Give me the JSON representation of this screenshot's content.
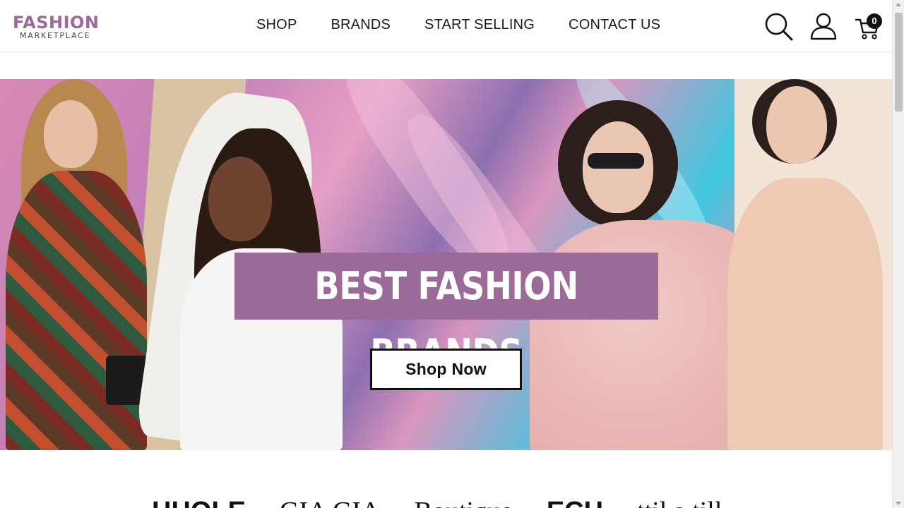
{
  "brand": {
    "name": "FASHION",
    "tagline": "MARKETPLACE",
    "accent": "#9b6a98"
  },
  "nav": {
    "items": [
      {
        "label": "SHOP"
      },
      {
        "label": "BRANDS"
      },
      {
        "label": "START SELLING"
      },
      {
        "label": "CONTACT US"
      }
    ]
  },
  "header_icons": {
    "search": "search-icon",
    "account": "user-icon",
    "cart": "cart-icon",
    "cart_count": "0"
  },
  "hero": {
    "headline": "BEST FASHION BRANDS",
    "cta": "Shop Now"
  },
  "brand_strip": {
    "logos": [
      "HHOLE",
      "GIA GIA",
      "Boutique",
      "ECH",
      "ttil a till"
    ]
  }
}
